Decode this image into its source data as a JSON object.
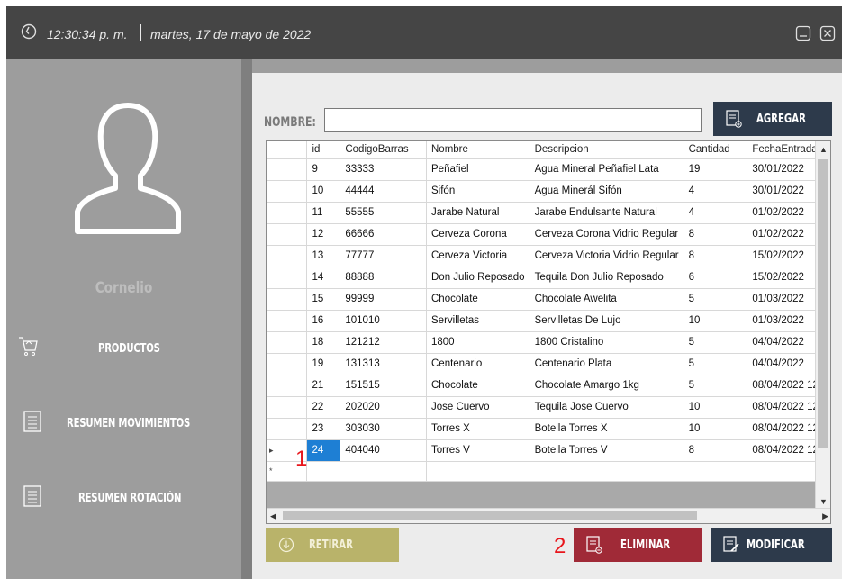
{
  "titlebar": {
    "time": "12:30:34 p. m.",
    "date": "martes, 17 de mayo de 2022",
    "icons": [
      "clock-icon",
      "minimize-icon",
      "close-icon"
    ]
  },
  "sidebar": {
    "user_name": "Cornelio",
    "avatar_icon": "user-avatar-icon",
    "items": [
      {
        "label": "PRODUCTOS",
        "icon": "shopping-cart-icon"
      },
      {
        "label": "RESUMEN MOVIMIENTOS",
        "icon": "document-list-icon"
      },
      {
        "label": "RESUMEN ROTACIÓN",
        "icon": "document-list-icon"
      }
    ]
  },
  "form": {
    "nombre_label": "NOMBRE:",
    "nombre_value": "",
    "agregar_label": "AGREGAR"
  },
  "table": {
    "columns": [
      "id",
      "CodigoBarras",
      "Nombre",
      "Descripcion",
      "Cantidad",
      "FechaEntrada"
    ],
    "rows": [
      [
        "9",
        "33333",
        "Peñafiel",
        "Agua Mineral Peñafiel Lata",
        "19",
        "30/01/2022"
      ],
      [
        "10",
        "44444",
        "Sifón",
        "Agua Minerál Sifón",
        "4",
        "30/01/2022"
      ],
      [
        "11",
        "55555",
        "Jarabe Natural",
        "Jarabe Endulsante Natural",
        "4",
        "01/02/2022"
      ],
      [
        "12",
        "66666",
        "Cerveza Corona",
        "Cerveza Corona Vidrio Regular",
        "8",
        "01/02/2022"
      ],
      [
        "13",
        "77777",
        "Cerveza Victoria",
        "Cerveza Victoria Vidrio Regular",
        "8",
        "15/02/2022"
      ],
      [
        "14",
        "88888",
        "Don Julio Reposado",
        "Tequila Don Julio Reposado",
        "6",
        "15/02/2022"
      ],
      [
        "15",
        "99999",
        "Chocolate",
        "Chocolate Awelita",
        "5",
        "01/03/2022"
      ],
      [
        "16",
        "101010",
        "Servilletas",
        "Servilletas De Lujo",
        "10",
        "01/03/2022"
      ],
      [
        "18",
        "121212",
        "1800",
        "1800 Cristalino",
        "5",
        "04/04/2022"
      ],
      [
        "19",
        "131313",
        "Centenario",
        "Centenario Plata",
        "5",
        "04/04/2022"
      ],
      [
        "21",
        "151515",
        "Chocolate",
        "Chocolate Amargo 1kg",
        "5",
        "08/04/2022 12:("
      ],
      [
        "22",
        "202020",
        "Jose Cuervo",
        "Tequila Jose Cuervo",
        "10",
        "08/04/2022 12:("
      ],
      [
        "23",
        "303030",
        "Torres X",
        "Botella Torres X",
        "10",
        "08/04/2022 12:("
      ],
      [
        "24",
        "404040",
        "Torres V",
        "Botella Torres V",
        "8",
        "08/04/2022 12:("
      ]
    ],
    "selected_row_index": 13,
    "current_row_marker": "▸",
    "new_row_marker": "*"
  },
  "actions": {
    "retirar_label": "RETIRAR",
    "eliminar_label": "ELIMINAR",
    "modificar_label": "MODIFICAR"
  },
  "annotations": {
    "marker_1": "1",
    "marker_2": "2",
    "color": "#e8161c"
  },
  "colors": {
    "titlebar": "#454545",
    "sidebar": "#9d9d9d",
    "navy_button": "#2d3a4b",
    "eliminar_button": "#a02a37",
    "retirar_button": "#b9b36a",
    "selection": "#1e7fd4"
  }
}
